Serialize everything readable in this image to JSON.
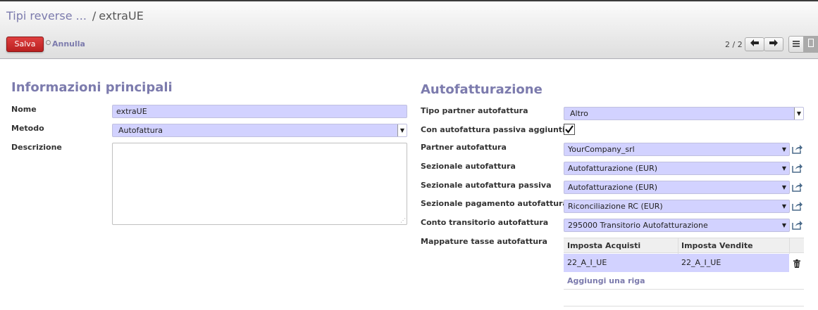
{
  "breadcrumb": {
    "parent": "Tipi reverse ...",
    "separator": "/",
    "current": "extraUE"
  },
  "toolbar": {
    "save_label": "Salva",
    "cancel_label": "Annulla"
  },
  "pager": {
    "value": "2 / 2",
    "prev_icon": "arrow-left-icon",
    "next_icon": "arrow-right-icon"
  },
  "views": {
    "list_icon": "list-view-icon",
    "form_icon": "form-view-icon"
  },
  "main_section": {
    "title": "Informazioni principali",
    "name": {
      "label": "Nome",
      "value": "extraUE"
    },
    "method": {
      "label": "Metodo",
      "value": "Autofattura"
    },
    "description": {
      "label": "Descrizione",
      "value": ""
    }
  },
  "self_invoice": {
    "title": "Autofatturazione",
    "partner_type": {
      "label": "Tipo partner autofattura",
      "value": "Altro"
    },
    "passive": {
      "label": "Con autofattura passiva aggiuntiva",
      "checked": true
    },
    "partner": {
      "label": "Partner autofattura",
      "value": "YourCompany_srl"
    },
    "journal": {
      "label": "Sezionale autofattura",
      "value": "Autofatturazione (EUR)"
    },
    "journal_passive": {
      "label": "Sezionale autofattura passiva",
      "value": "Autofatturazione (EUR)"
    },
    "payment_journal": {
      "label": "Sezionale pagamento autofattura",
      "value": "Riconciliazione RC (EUR)"
    },
    "transit_account": {
      "label": "Conto transitorio autofattura",
      "value": "295000 Transitorio Autofatturazione"
    },
    "tax_mapping": {
      "label": "Mappature tasse autofattura",
      "columns": [
        "Imposta Acquisti",
        "Imposta Vendite"
      ],
      "rows": [
        [
          "22_A_I_UE",
          "22_A_I_UE"
        ]
      ],
      "add_label": "Aggiungi una riga"
    }
  },
  "colors": {
    "accent": "#7c7bad",
    "save": "#c9302c",
    "field_bg": "#d2d2ff"
  }
}
